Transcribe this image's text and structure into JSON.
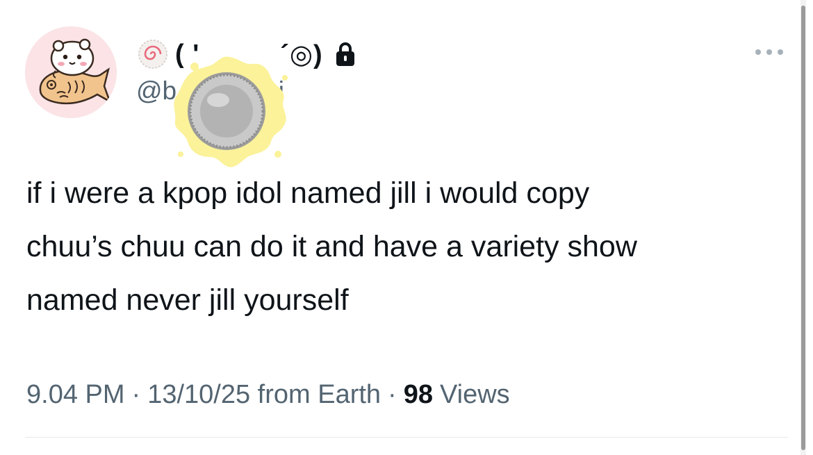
{
  "author": {
    "display_name_prefix": "( '",
    "display_name_suffix": "´◎)",
    "handle": "@b",
    "handle_trailing": "i",
    "avatar_icon": "hamster-on-taiyaki-avatar",
    "badge_icon": "narutomaki-badge-icon",
    "protected_icon": "lock-icon"
  },
  "tweet": {
    "text_lines": [
      "if i were a kpop idol named jill i would copy",
      "chuu’s chuu can do it and have a variety show",
      "named never jill yourself"
    ]
  },
  "meta": {
    "time": "9.04 PM",
    "separator": "·",
    "date_source": "13/10/25 from Earth",
    "views_count": "98",
    "views_label": "Views"
  },
  "actions": {
    "more_icon": "more-options-icon"
  },
  "overlay": {
    "sticker_icon": "coin-splash-sticker"
  },
  "colors": {
    "text_primary": "#0f1419",
    "text_secondary": "#536471",
    "avatar_bg": "#fbe3e6",
    "divider": "#e6e9ec",
    "splash_yellow": "#fbf29a",
    "coin_gray": "#b9b9b9"
  }
}
